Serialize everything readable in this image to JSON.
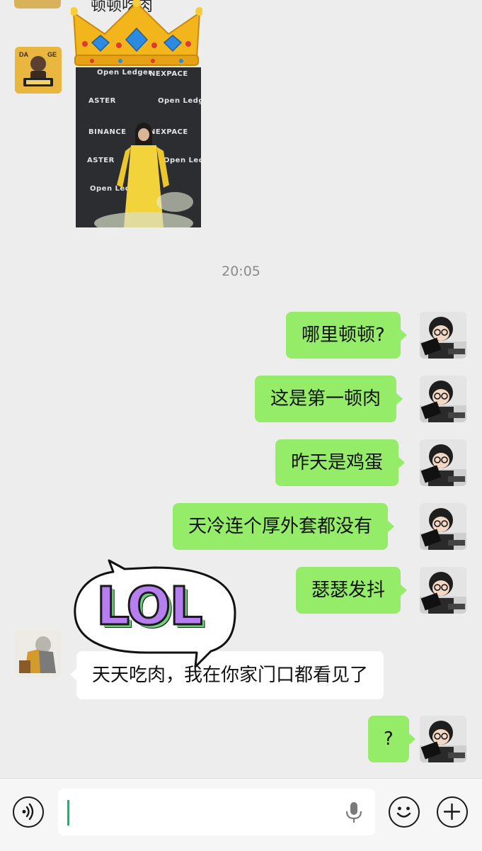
{
  "top_partial_text": "顿顿吃肉",
  "time_separator": "20:05",
  "image_message": {
    "logos": [
      "Open Ledger",
      "NEXPACE",
      "ASTER",
      "Open Ledger",
      "BINANCE",
      "NEXPACE",
      "ASTER",
      "Open Ledger",
      "Open Ledger"
    ]
  },
  "messages_out": [
    {
      "text": "哪里顿顿?"
    },
    {
      "text": "这是第一顿肉"
    },
    {
      "text": "昨天是鸡蛋"
    },
    {
      "text": "天冷连个厚外套都没有"
    },
    {
      "text": "瑟瑟发抖"
    }
  ],
  "message_in": {
    "text": "天天吃肉，我在你家门口都看见了"
  },
  "last_out": {
    "text": "?"
  },
  "sticker": {
    "text": "LOL"
  },
  "colors": {
    "background": "#ededed",
    "outgoing_bubble": "#95ec69",
    "incoming_bubble": "#ffffff",
    "caret": "#07c160"
  },
  "icons": [
    "voice-mode-icon",
    "microphone-icon",
    "emoji-icon",
    "plus-icon"
  ]
}
